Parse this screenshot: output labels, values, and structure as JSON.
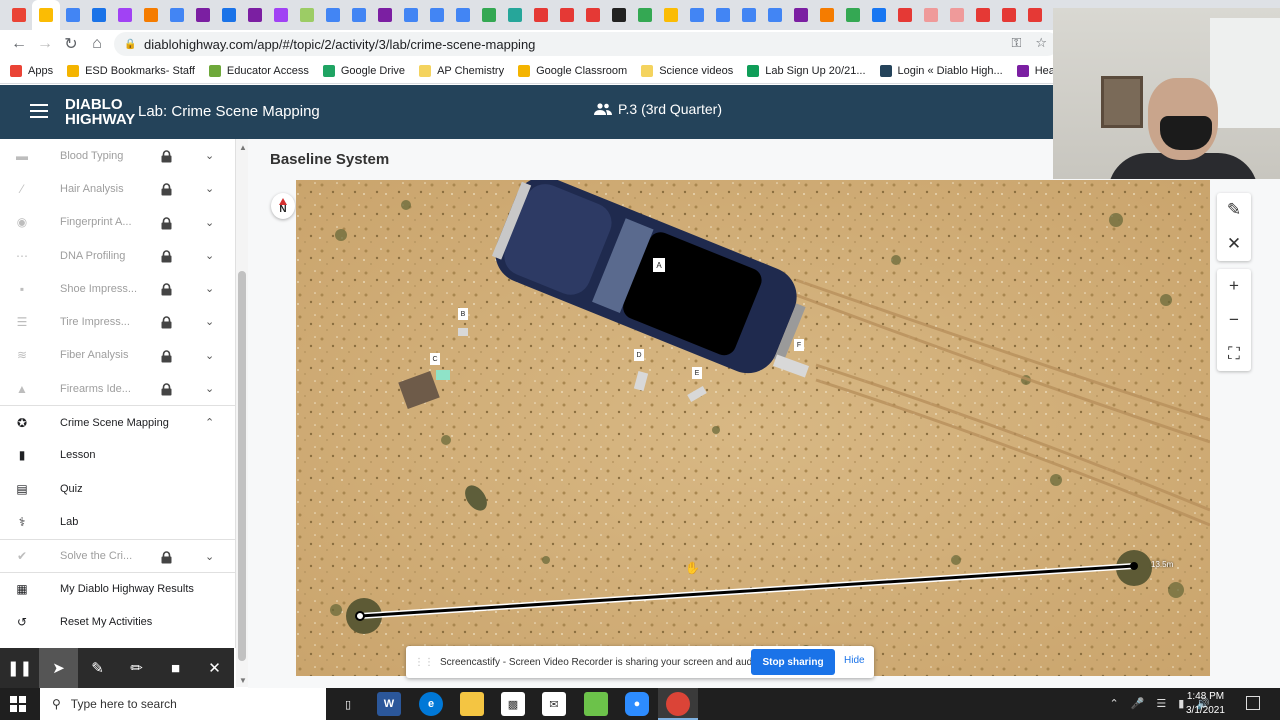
{
  "browser": {
    "url": "diablohighway.com/app/#/topic/2/activity/3/lab/crime-scene-mapping",
    "tab_colors": [
      "#ea4335",
      "#fbbc04",
      "#4285f4",
      "#1a73e8",
      "#a142f4",
      "#f57c00",
      "#4285f4",
      "#7b1fa2",
      "#1a73e8",
      "#7b1fa2",
      "#a142f4",
      "#9ccc65",
      "#4285f4",
      "#4285f4",
      "#7b1fa2",
      "#4285f4",
      "#4285f4",
      "#4285f4",
      "#34a853",
      "#26a69a",
      "#e53935",
      "#e53935",
      "#e53935",
      "#222222",
      "#34a853",
      "#fbbc04",
      "#4285f4",
      "#4285f4",
      "#4285f4",
      "#4285f4",
      "#7b1fa2",
      "#f57c00",
      "#34a853",
      "#1877f2",
      "#e53935",
      "#ef9a9a",
      "#ef9a9a",
      "#e53935",
      "#e53935",
      "#e53935"
    ],
    "bookmarks": [
      {
        "label": "Apps",
        "color": "#ea4335"
      },
      {
        "label": "ESD Bookmarks- Staff",
        "color": "#f4b400"
      },
      {
        "label": "Educator Access",
        "color": "#6ea83a"
      },
      {
        "label": "Google Drive",
        "color": "#1fa463"
      },
      {
        "label": "AP Chemistry",
        "color": "#f4d35e"
      },
      {
        "label": "Google Classroom",
        "color": "#f4b400"
      },
      {
        "label": "Science videos",
        "color": "#f4d35e"
      },
      {
        "label": "Lab Sign Up 20/21...",
        "color": "#0f9d58"
      },
      {
        "label": "Login « Diablo High...",
        "color": "#24435a"
      },
      {
        "label": "Health Check:",
        "color": "#7b1fa2"
      }
    ]
  },
  "header": {
    "logo_line1": "DIABLO",
    "logo_line2": "HIGHWAY",
    "title": "Lab: Crime Scene Mapping",
    "period": "P.3 (3rd Quarter)"
  },
  "sidebar": {
    "items": [
      {
        "label": "Blood Typing",
        "icon": "drop-icon",
        "locked": true
      },
      {
        "label": "Hair Analysis",
        "icon": "hair-icon",
        "locked": true
      },
      {
        "label": "Fingerprint A...",
        "icon": "fingerprint-icon",
        "locked": true
      },
      {
        "label": "DNA Profiling",
        "icon": "dna-icon",
        "locked": true
      },
      {
        "label": "Shoe Impress...",
        "icon": "shoe-icon",
        "locked": true
      },
      {
        "label": "Tire Impress...",
        "icon": "tire-icon",
        "locked": true
      },
      {
        "label": "Fiber Analysis",
        "icon": "fiber-icon",
        "locked": true
      },
      {
        "label": "Firearms Ide...",
        "icon": "bullet-icon",
        "locked": true
      }
    ],
    "active_section": {
      "label": "Crime Scene Mapping",
      "icon": "compass-icon"
    },
    "sub_items": [
      {
        "label": "Lesson",
        "icon": "book-icon"
      },
      {
        "label": "Quiz",
        "icon": "clipboard-icon"
      },
      {
        "label": "Lab",
        "icon": "flask-icon"
      }
    ],
    "solve": {
      "label": "Solve the Cri...",
      "icon": "check-circle-icon"
    },
    "results": "My Diablo Highway Results",
    "reset": "Reset My Activities"
  },
  "main": {
    "title": "Baseline System",
    "compass_label": "N",
    "markers": [
      "A",
      "B",
      "C",
      "D",
      "E",
      "F"
    ],
    "measurement_label": "13.5m"
  },
  "notice": {
    "text": "Screencastify - Screen Video Recorder is sharing your screen and audio.",
    "stop": "Stop sharing",
    "hide": "Hide"
  },
  "taskbar": {
    "search_placeholder": "Type here to search",
    "time": "1:48 PM",
    "date": "3/1/2021"
  }
}
